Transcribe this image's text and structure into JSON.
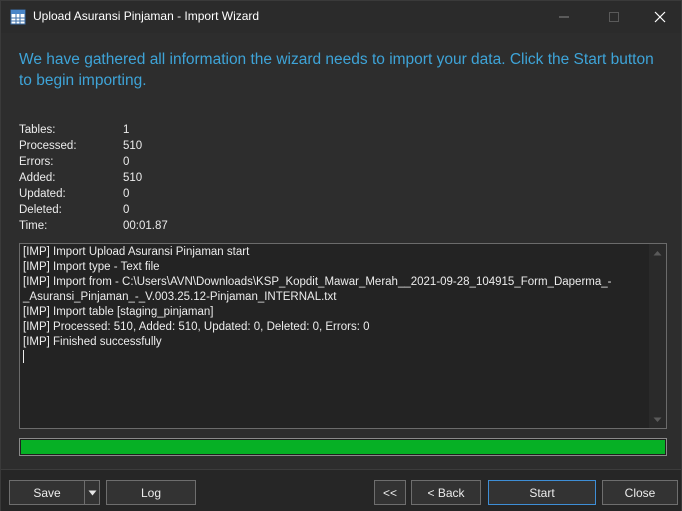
{
  "window": {
    "title": "Upload Asuransi Pinjaman - Import Wizard",
    "icon": "table-import-icon"
  },
  "header": {
    "message": "We have gathered all information the wizard needs to import your data. Click the Start button to begin importing."
  },
  "stats": {
    "rows": [
      {
        "label": "Tables:",
        "value": "1"
      },
      {
        "label": "Processed:",
        "value": "510"
      },
      {
        "label": "Errors:",
        "value": "0"
      },
      {
        "label": "Added:",
        "value": "510"
      },
      {
        "label": "Updated:",
        "value": "0"
      },
      {
        "label": "Deleted:",
        "value": "0"
      },
      {
        "label": "Time:",
        "value": "00:01.87"
      }
    ]
  },
  "log": {
    "lines": [
      "[IMP] Import Upload Asuransi Pinjaman start",
      "[IMP] Import type - Text file",
      "[IMP] Import from - C:\\Users\\AVN\\Downloads\\KSP_Kopdit_Mawar_Merah__2021-09-28_104915_Form_Daperma_-",
      "_Asuransi_Pinjaman_-_V.003.25.12-Pinjaman_INTERNAL.txt",
      "[IMP] Import table [staging_pinjaman]",
      "[IMP] Processed: 510, Added: 510, Updated: 0, Deleted: 0, Errors: 0",
      "[IMP] Finished successfully"
    ]
  },
  "progress": {
    "percent": 100,
    "color": "#06b025"
  },
  "buttons": {
    "save": "Save",
    "log": "Log",
    "first": "<<",
    "back": "< Back",
    "start": "Start",
    "close": "Close"
  },
  "colors": {
    "accent": "#3ea4d8",
    "primary_border": "#3e8ed6"
  }
}
